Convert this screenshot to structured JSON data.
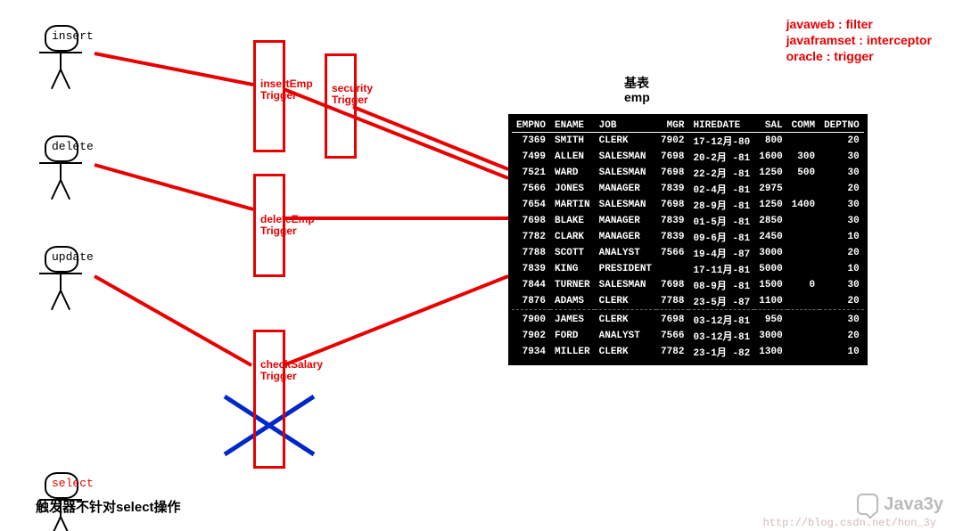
{
  "sticks": {
    "insert": "insert",
    "delete": "delete",
    "update": "update",
    "select": "select"
  },
  "triggers": {
    "insertEmp": {
      "l1": "insertEmp",
      "l2": "Trigger"
    },
    "security": {
      "l1": "security",
      "l2": "Trigger"
    },
    "deleteEmp": {
      "l1": "deleteEmp",
      "l2": "Trigger"
    },
    "checkSalary": {
      "l1": "checkSalary",
      "l2": "Trigger"
    }
  },
  "note": {
    "l1": "javaweb : filter",
    "l2": "javaframset : interceptor",
    "l3": "oracle : trigger"
  },
  "tableTitle": {
    "l1": "基表",
    "l2": "emp"
  },
  "columns": [
    "EMPNO",
    "ENAME",
    "JOB",
    "MGR",
    "HIREDATE",
    "SAL",
    "COMM",
    "DEPTNO"
  ],
  "rows": [
    [
      "7369",
      "SMITH",
      "CLERK",
      "7902",
      "17-12月-80",
      "800",
      "",
      "20"
    ],
    [
      "7499",
      "ALLEN",
      "SALESMAN",
      "7698",
      "20-2月 -81",
      "1600",
      "300",
      "30"
    ],
    [
      "7521",
      "WARD",
      "SALESMAN",
      "7698",
      "22-2月 -81",
      "1250",
      "500",
      "30"
    ],
    [
      "7566",
      "JONES",
      "MANAGER",
      "7839",
      "02-4月 -81",
      "2975",
      "",
      "20"
    ],
    [
      "7654",
      "MARTIN",
      "SALESMAN",
      "7698",
      "28-9月 -81",
      "1250",
      "1400",
      "30"
    ],
    [
      "7698",
      "BLAKE",
      "MANAGER",
      "7839",
      "01-5月 -81",
      "2850",
      "",
      "30"
    ],
    [
      "7782",
      "CLARK",
      "MANAGER",
      "7839",
      "09-6月 -81",
      "2450",
      "",
      "10"
    ],
    [
      "7788",
      "SCOTT",
      "ANALYST",
      "7566",
      "19-4月 -87",
      "3000",
      "",
      "20"
    ],
    [
      "7839",
      "KING",
      "PRESIDENT",
      "",
      "17-11月-81",
      "5000",
      "",
      "10"
    ],
    [
      "7844",
      "TURNER",
      "SALESMAN",
      "7698",
      "08-9月 -81",
      "1500",
      "0",
      "30"
    ],
    [
      "7876",
      "ADAMS",
      "CLERK",
      "7788",
      "23-5月 -87",
      "1100",
      "",
      "20"
    ],
    [
      "7900",
      "JAMES",
      "CLERK",
      "7698",
      "03-12月-81",
      "950",
      "",
      "30"
    ],
    [
      "7902",
      "FORD",
      "ANALYST",
      "7566",
      "03-12月-81",
      "3000",
      "",
      "20"
    ],
    [
      "7934",
      "MILLER",
      "CLERK",
      "7782",
      "23-1月 -82",
      "1300",
      "",
      "10"
    ]
  ],
  "bottom": "触发器不针对select操作",
  "watermark": "Java3y",
  "url": "http://blog.csdn.net/hon_3y"
}
